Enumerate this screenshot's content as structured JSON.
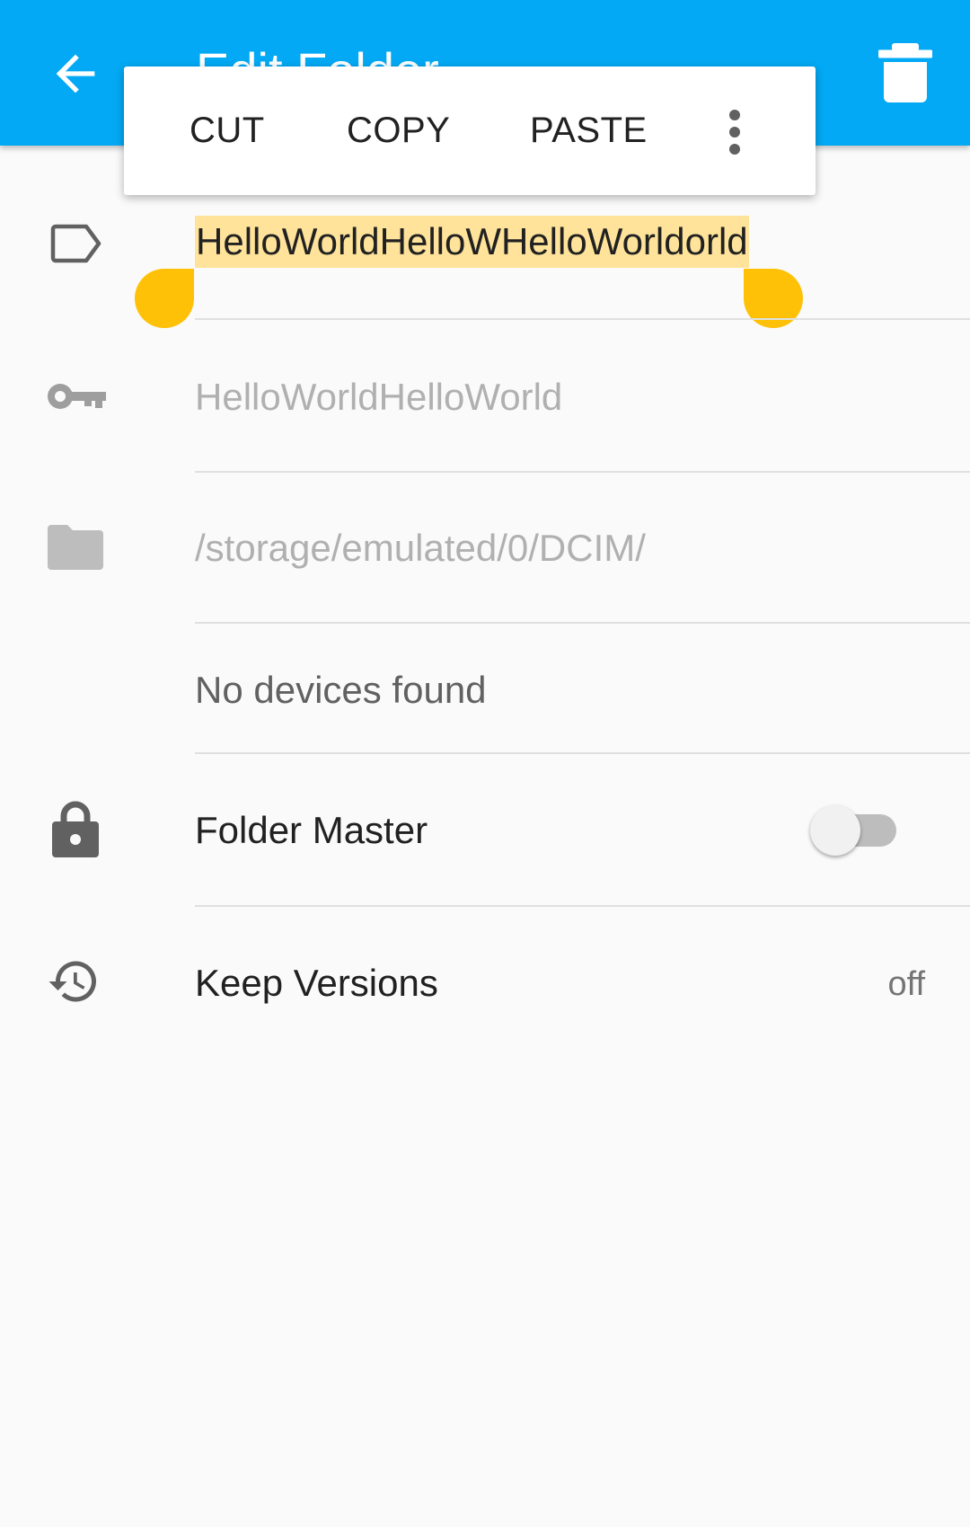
{
  "toolbar": {
    "title": "Edit Folder",
    "back_icon": "arrow-left-icon",
    "delete_icon": "trash-icon"
  },
  "context_menu": {
    "cut": "CUT",
    "copy": "COPY",
    "paste": "PASTE",
    "more_icon": "more-vert-icon"
  },
  "form": {
    "folder_label_value": "HelloWorldHelloWHelloWorldorld",
    "folder_id_placeholder": "HelloWorldHelloWorld",
    "directory_placeholder": "/storage/emulated/0/DCIM/",
    "devices_text": "No devices found",
    "folder_master_label": "Folder Master",
    "folder_master_on": false,
    "keep_versions_label": "Keep Versions",
    "keep_versions_value": "off"
  },
  "colors": {
    "appbar": "#03a9f4",
    "selection_highlight": "#ffe39a",
    "selection_handle": "#ffc107",
    "background": "#fafafa"
  }
}
